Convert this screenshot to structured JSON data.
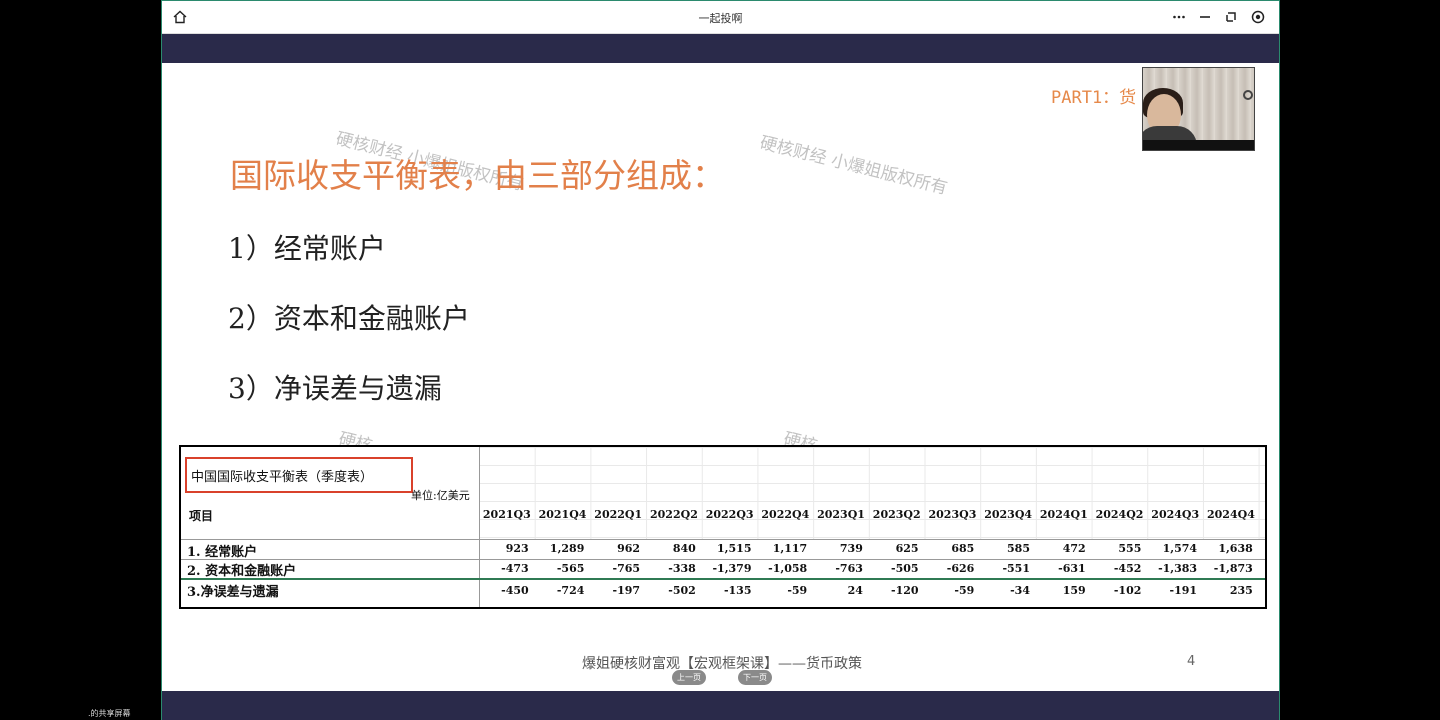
{
  "window": {
    "title": "一起投啊",
    "home_icon": "home-icon",
    "more_icon": "more-icon",
    "minimize_icon": "minimize-icon",
    "restore_icon": "restore-icon",
    "close_icon": "close-icon"
  },
  "slide": {
    "part_label": "PART1：货",
    "heading": "国际收支平衡表，由三部分组成：",
    "items": [
      "1）经常账户",
      "2）资本和金融账户",
      "3）净误差与遗漏"
    ],
    "watermarks": [
      "硬核财经 小爆姐版权所有",
      "硬核财经 小爆姐版权所有",
      "硬核",
      "硬核"
    ],
    "footer": "爆姐硬核财富观【宏观框架课】——货币政策",
    "page_number": "4",
    "prev_button": "上一页",
    "next_button": "下一页"
  },
  "table": {
    "title": "中国国际收支平衡表（季度表）",
    "unit": "单位:亿美元",
    "project_header": "项目",
    "columns": [
      "2021Q3",
      "2021Q4",
      "2022Q1",
      "2022Q2",
      "2022Q3",
      "2022Q4",
      "2023Q1",
      "2023Q2",
      "2023Q3",
      "2023Q4",
      "2024Q1",
      "2024Q2",
      "2024Q3",
      "2024Q4"
    ],
    "rows": [
      {
        "label": "1. 经常账户",
        "values": [
          "923",
          "1,289",
          "962",
          "840",
          "1,515",
          "1,117",
          "739",
          "625",
          "685",
          "585",
          "472",
          "555",
          "1,574",
          "1,638"
        ]
      },
      {
        "label": "2. 资本和金融账户",
        "values": [
          "-473",
          "-565",
          "-765",
          "-338",
          "-1,379",
          "-1,058",
          "-763",
          "-505",
          "-626",
          "-551",
          "-631",
          "-452",
          "-1,383",
          "-1,873"
        ]
      },
      {
        "label": "3.净误差与遗漏",
        "values": [
          "-450",
          "-724",
          "-197",
          "-502",
          "-135",
          "-59",
          "24",
          "-120",
          "-59",
          "-34",
          "159",
          "-102",
          "-191",
          "235"
        ]
      }
    ]
  },
  "taskbar": {
    "share_label": ".的共享屏幕"
  },
  "colors": {
    "accent_orange": "#e2804a",
    "nav_band": "#2a2a4a",
    "highlight_red": "#d9412b",
    "row_divider_green": "#2f7a53"
  }
}
